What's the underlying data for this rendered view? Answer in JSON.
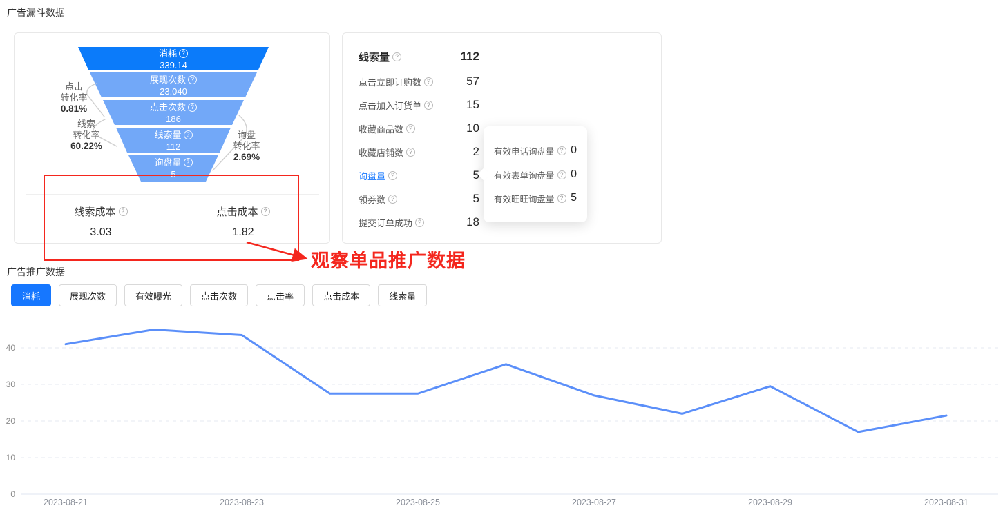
{
  "funnel_section": {
    "title": "广告漏斗数据",
    "funnel": {
      "bands": [
        {
          "label": "消耗",
          "value": "339.14",
          "color": "#0b7bfa"
        },
        {
          "label": "展现次数",
          "value": "23,040",
          "color": "#72a8f8"
        },
        {
          "label": "点击次数",
          "value": "186",
          "color": "#72a8f8"
        },
        {
          "label": "线索量",
          "value": "112",
          "color": "#72a8f8"
        },
        {
          "label": "询盘量",
          "value": "5",
          "color": "#72a8f8"
        }
      ],
      "side_labels": [
        {
          "lines": [
            "点击",
            "转化率"
          ],
          "value": "0.81%",
          "side": "left"
        },
        {
          "lines": [
            "线索",
            "转化率"
          ],
          "value": "60.22%",
          "side": "left"
        },
        {
          "lines": [
            "询盘",
            "转化率"
          ],
          "value": "2.69%",
          "side": "right"
        }
      ]
    },
    "costs": [
      {
        "label": "线索成本",
        "value": "3.03"
      },
      {
        "label": "点击成本",
        "value": "1.82"
      }
    ]
  },
  "stats_panel": {
    "rows": [
      {
        "label": "线索量",
        "value": "112"
      },
      {
        "label": "点击立即订购数",
        "value": "57"
      },
      {
        "label": "点击加入订货单",
        "value": "15"
      },
      {
        "label": "收藏商品数",
        "value": "10"
      },
      {
        "label": "收藏店铺数",
        "value": "2"
      },
      {
        "label": "询盘量",
        "value": "5"
      },
      {
        "label": "领券数",
        "value": "5"
      },
      {
        "label": "提交订单成功",
        "value": "18"
      }
    ]
  },
  "tooltip": {
    "rows": [
      {
        "label": "有效电话询盘量",
        "value": "0"
      },
      {
        "label": "有效表单询盘量",
        "value": "0"
      },
      {
        "label": "有效旺旺询盘量",
        "value": "5"
      }
    ]
  },
  "annotation": {
    "text": "观察单品推广数据",
    "color": "#f4271e"
  },
  "promo_section": {
    "title": "广告推广数据",
    "tabs": [
      {
        "label": "消耗"
      },
      {
        "label": "展现次数"
      },
      {
        "label": "有效曝光"
      },
      {
        "label": "点击次数"
      },
      {
        "label": "点击率"
      },
      {
        "label": "点击成本"
      },
      {
        "label": "线索量"
      }
    ],
    "active_tab": "消耗"
  },
  "chart_data": {
    "type": "line",
    "title": "广告推广数据 - 消耗",
    "series_name": "消耗",
    "x": [
      "2023-08-21",
      "2023-08-22",
      "2023-08-23",
      "2023-08-24",
      "2023-08-25",
      "2023-08-26",
      "2023-08-27",
      "2023-08-28",
      "2023-08-29",
      "2023-08-30",
      "2023-08-31"
    ],
    "values": [
      41,
      45,
      43.5,
      27.5,
      27.5,
      35.5,
      27,
      22,
      29.5,
      17,
      21.5
    ],
    "x_tick_labels": [
      "2023-08-21",
      "2023-08-23",
      "2023-08-25",
      "2023-08-27",
      "2023-08-29",
      "2023-08-31"
    ],
    "y_ticks": [
      0,
      10,
      20,
      30,
      40
    ],
    "ylim": [
      0,
      49
    ],
    "grid": "dashed-horizontal",
    "legend": "none",
    "line_color": "#5b8ff9"
  }
}
